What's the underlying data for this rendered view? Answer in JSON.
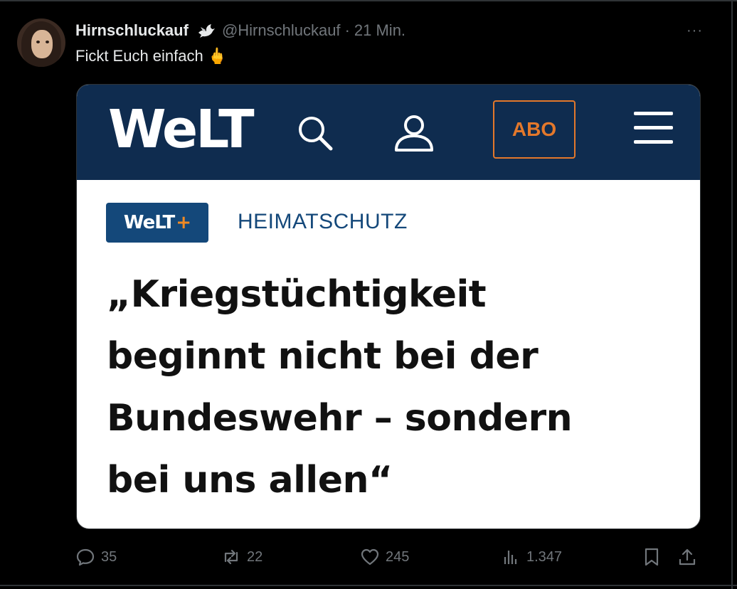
{
  "tweet": {
    "display_name": "Hirnschluckauf",
    "badge_icon": "dove-icon",
    "handle": "@Hirnschluckauf",
    "separator": "·",
    "time": "21 Min.",
    "more_label": "···",
    "text": "Fickt Euch einfach 🖕"
  },
  "card": {
    "logo": "WeLT",
    "abo_label": "ABO",
    "plus_badge": {
      "text": "WeLT",
      "plus": "+"
    },
    "rubric": "HEIMATSCHUTZ",
    "headline_lines": [
      "„Kriegstüchtigkeit",
      "beginnt nicht bei der",
      "Bundeswehr – sondern",
      "bei uns allen“"
    ],
    "colors": {
      "header_bg": "#0f2c4f",
      "abo_accent": "#e3782b",
      "badge_bg": "#14487a"
    }
  },
  "actions": {
    "replies": "35",
    "reposts": "22",
    "likes": "245",
    "views": "1.347"
  }
}
